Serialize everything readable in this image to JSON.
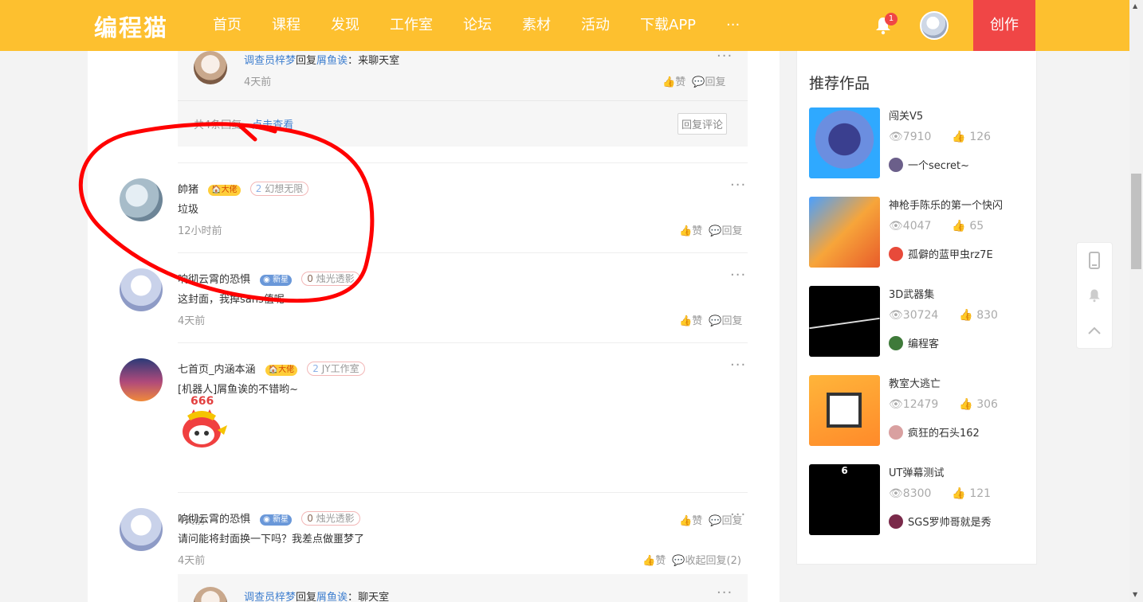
{
  "header": {
    "logo": "编程猫",
    "nav": [
      "首页",
      "课程",
      "发现",
      "工作室",
      "论坛",
      "素材",
      "活动",
      "下载APP",
      "···"
    ],
    "notification_count": "1",
    "create_label": "创作"
  },
  "thread_top": {
    "sub_reply": {
      "author": "调查员梓梦",
      "verb": "回复",
      "target": "屑鱼诶",
      "sep": "：",
      "text": "来聊天室",
      "time": "4天前",
      "like": "赞",
      "reply": "回复"
    },
    "summary_count": "共4条回复，",
    "summary_link": "点击查看",
    "reply_button": "回复评论"
  },
  "comments": [
    {
      "name": "帥猪",
      "badge1": "大佬",
      "badge2": "幻想无限",
      "badge2_num": "2",
      "text": "垃圾",
      "time": "12小时前",
      "like": "赞",
      "reply": "回复"
    },
    {
      "name": "响彻云霄的恐惧",
      "badge1": "新星",
      "badge2": "烛光透影",
      "badge2_num": "0",
      "text": "这封面，我掉sans值呢",
      "time": "4天前",
      "like": "赞",
      "reply": "回复"
    },
    {
      "name": "七首页_内涵本涵",
      "badge1": "大佬",
      "badge2": "JY工作室",
      "badge2_num": "2",
      "text": "[机器人]屑鱼诶的不错哟~",
      "sticker_text": "666",
      "time": "4天前",
      "like": "赞",
      "reply": "回复"
    },
    {
      "name": "响彻云霄的恐惧",
      "badge1": "新星",
      "badge2": "烛光透影",
      "badge2_num": "0",
      "text": "请问能将封面换一下吗？我差点做噩梦了",
      "time": "4天前",
      "like": "赞",
      "reply": "收起回复(2)"
    }
  ],
  "thread_bottom": {
    "author": "调查员梓梦",
    "verb": "回复",
    "target": "屑鱼诶",
    "sep": "：",
    "text": "聊天室"
  },
  "sidebar": {
    "title": "推荐作品",
    "works": [
      {
        "title": "闯关V5",
        "views": "7910",
        "likes": "126",
        "author": "一个secret~"
      },
      {
        "title": "神枪手陈乐的第一个快闪",
        "views": "4047",
        "likes": "65",
        "author": "孤僻的蓝甲虫rz7E"
      },
      {
        "title": "3D武器集",
        "views": "30724",
        "likes": "830",
        "author": "编程客"
      },
      {
        "title": "教室大逃亡",
        "views": "12479",
        "likes": "306",
        "author": "疯狂的石头162"
      },
      {
        "title": "UT弹幕测试",
        "views": "8300",
        "likes": "121",
        "author": "SGS罗帅哥就是秀",
        "thumb_text": "6"
      }
    ]
  },
  "colors": {
    "brand": "#fdc02f",
    "create": "#f04646",
    "link": "#3f7fcf",
    "annotation": "#ff0000"
  }
}
